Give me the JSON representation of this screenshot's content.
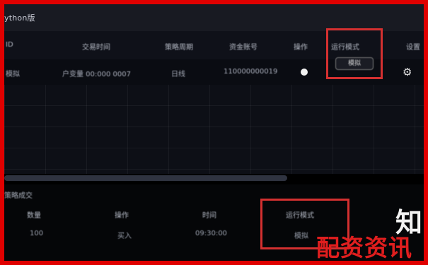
{
  "window": {
    "title": "ython版"
  },
  "table": {
    "headers": [
      "ID",
      "交易时间",
      "策略周期",
      "资金账号",
      "操作",
      "运行模式",
      "设置"
    ],
    "row": {
      "id": "模拟",
      "time": "户变量 00:000 0007",
      "cycle": "日线",
      "account": "110000000019",
      "mode": "模拟"
    },
    "gear_icon": "gear-icon"
  },
  "bottom": {
    "title": "策略成交",
    "headers": [
      "数量",
      "操作",
      "时间",
      "运行模式"
    ],
    "values": [
      "100",
      "买入",
      "09:30:00",
      "模拟"
    ]
  },
  "overlay": {
    "big_char": "知",
    "watermark": "配资资讯"
  },
  "colors": {
    "highlight_box": "#d43030",
    "watermark": "#e01e1e",
    "frame": "#e00000"
  }
}
